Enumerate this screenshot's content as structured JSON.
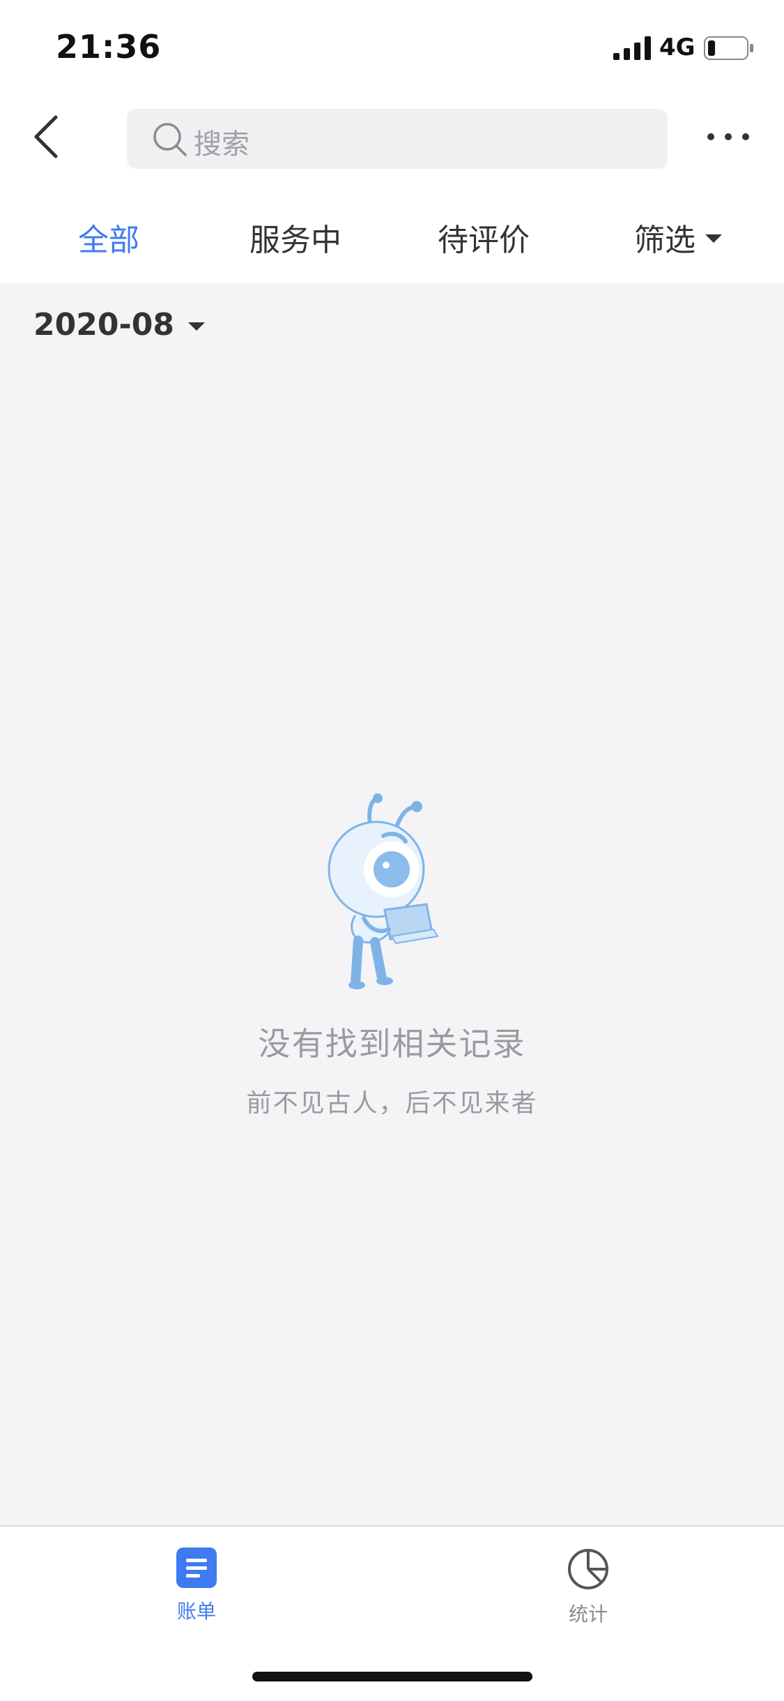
{
  "status_bar": {
    "time": "21:36",
    "network": "4G"
  },
  "nav_bar": {
    "search_placeholder": "搜索"
  },
  "tabs": [
    {
      "label": "全部",
      "active": true
    },
    {
      "label": "服务中",
      "active": false
    },
    {
      "label": "待评价",
      "active": false
    },
    {
      "label": "筛选",
      "active": false
    }
  ],
  "month_selector": {
    "value": "2020-08"
  },
  "empty_state": {
    "title": "没有找到相关记录",
    "subtitle": "前不见古人，后不见来者"
  },
  "bottom_tabs": [
    {
      "label": "账单",
      "active": true,
      "icon": "bill-icon"
    },
    {
      "label": "统计",
      "active": false,
      "icon": "pie-chart-icon"
    }
  ],
  "colors": {
    "accent": "#3f7bf0",
    "background": "#f4f4f6",
    "muted_text": "#9a9aa0"
  }
}
